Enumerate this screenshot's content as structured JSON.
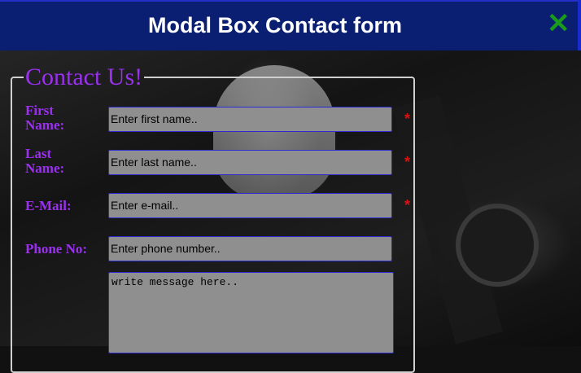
{
  "header": {
    "title": "Modal Box Contact form",
    "close_icon": "close-icon"
  },
  "form": {
    "legend": "Contact Us!",
    "first_name": {
      "label": "First Name:",
      "placeholder": "Enter first name..",
      "required_mark": "*"
    },
    "last_name": {
      "label": "Last Name:",
      "placeholder": "Enter last name..",
      "required_mark": "*"
    },
    "email": {
      "label": "E-Mail:",
      "placeholder": "Enter e-mail..",
      "required_mark": "*"
    },
    "phone": {
      "label": "Phone No:",
      "placeholder": "Enter phone number.."
    },
    "message": {
      "placeholder": "write message here.."
    }
  },
  "colors": {
    "header_bg": "#0a1f72",
    "label": "#9b30f0",
    "required": "#e01010",
    "close": "#1a9c1a"
  }
}
